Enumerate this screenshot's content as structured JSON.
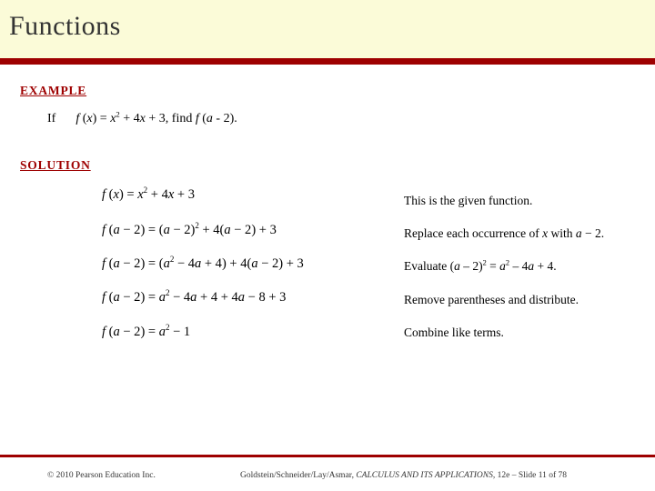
{
  "header": {
    "title": "Functions",
    "band_color": "#fbfbd8",
    "rule_color": "#9e0000"
  },
  "labels": {
    "example": "EXAMPLE",
    "solution": "SOLUTION",
    "accent_color": "#9e0000"
  },
  "example": {
    "if_word": "If",
    "function_def_plain": "f(x) = x² + 4x + 3",
    "prompt_plain": ", find f (a - 2)."
  },
  "equations": [
    "f(x) = x² + 4x + 3",
    "f(a − 2) = (a − 2)² + 4(a − 2) + 3",
    "f(a − 2) = (a² − 4a + 4) + 4(a − 2) + 3",
    "f(a − 2) = a² − 4a + 4 + 4a − 8 + 3",
    "f(a − 2) = a² − 1"
  ],
  "notes": [
    "This is the given function.",
    "Replace each occurrence of x with a − 2.",
    "Evaluate (a − 2)2 = a2 − 4a + 4.",
    "Remove parentheses and distribute.",
    "Combine like terms."
  ],
  "footer": {
    "copyright": "© 2010 Pearson Education Inc.",
    "credit_prefix": "Goldstein/Schneider/Lay/Asmar, ",
    "credit_italic": "CALCULUS AND ITS APPLICATIONS",
    "credit_suffix": ", 12e – Slide 11 of 78"
  }
}
